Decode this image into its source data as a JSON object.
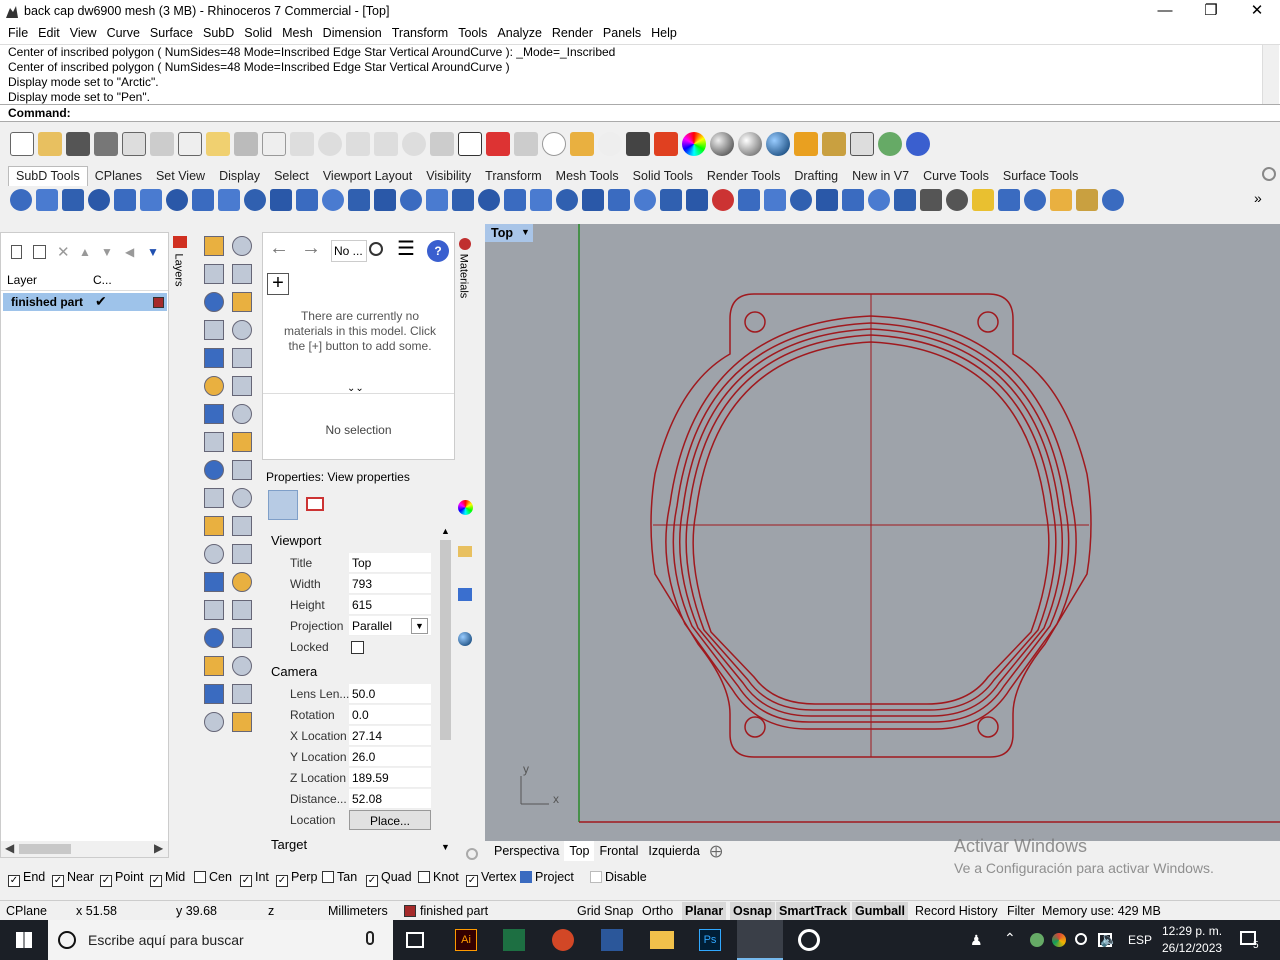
{
  "window": {
    "title": "back cap dw6900 mesh (3 MB) - Rhinoceros 7 Commercial - [Top]"
  },
  "menu": [
    "File",
    "Edit",
    "View",
    "Curve",
    "Surface",
    "SubD",
    "Solid",
    "Mesh",
    "Dimension",
    "Transform",
    "Tools",
    "Analyze",
    "Render",
    "Panels",
    "Help"
  ],
  "command_history": [
    "Center of inscribed polygon ( NumSides=48  Mode=Inscribed  Edge  Star  Vertical  AroundCurve ): _Mode=_Inscribed",
    "Center of inscribed polygon ( NumSides=48  Mode=Inscribed  Edge  Star  Vertical  AroundCurve )",
    "Display mode set to \"Arctic\".",
    "Display mode set to \"Pen\"."
  ],
  "command_label": "Command:",
  "toolbar_tabs": [
    "SubD Tools",
    "CPlanes",
    "Set View",
    "Display",
    "Select",
    "Viewport Layout",
    "Visibility",
    "Transform",
    "Mesh Tools",
    "Solid Tools",
    "Render Tools",
    "Drafting",
    "New in V7",
    "Curve Tools",
    "Surface Tools"
  ],
  "layers": {
    "tab_label": "Layers",
    "col_layer": "Layer",
    "col_current": "C...",
    "row_name": "finished part",
    "row_color": "#a52a2a"
  },
  "materials": {
    "tab_label": "Materials",
    "search_placeholder": "No ...",
    "empty_text": "There are currently no materials in this model. Click the [+] button to add some.",
    "no_selection": "No selection"
  },
  "properties": {
    "header": "Properties: View properties",
    "section_viewport": "Viewport",
    "section_camera": "Camera",
    "section_target": "Target",
    "viewport_rows": [
      {
        "label": "Title",
        "value": "Top"
      },
      {
        "label": "Width",
        "value": "793"
      },
      {
        "label": "Height",
        "value": "615"
      },
      {
        "label": "Projection",
        "value": "Parallel"
      },
      {
        "label": "Locked",
        "value": ""
      }
    ],
    "camera_rows": [
      {
        "label": "Lens Len...",
        "value": "50.0"
      },
      {
        "label": "Rotation",
        "value": "0.0"
      },
      {
        "label": "X Location",
        "value": "27.14"
      },
      {
        "label": "Y Location",
        "value": "26.0"
      },
      {
        "label": "Z Location",
        "value": "189.59"
      },
      {
        "label": "Distance...",
        "value": "52.08"
      },
      {
        "label": "Location",
        "value": "Place..."
      }
    ]
  },
  "viewport": {
    "name": "Top",
    "axis_x": "x",
    "axis_y": "y",
    "curve_color": "#a0191e"
  },
  "viewport_tabs": [
    "Perspectiva",
    "Top",
    "Frontal",
    "Izquierda"
  ],
  "activate": {
    "line1": "Activar Windows",
    "line2": "Ve a Configuración para activar Windows."
  },
  "osnaps": [
    {
      "label": "End",
      "checked": true
    },
    {
      "label": "Near",
      "checked": true
    },
    {
      "label": "Point",
      "checked": true
    },
    {
      "label": "Mid",
      "checked": true
    },
    {
      "label": "Cen",
      "checked": false
    },
    {
      "label": "Int",
      "checked": true
    },
    {
      "label": "Perp",
      "checked": true
    },
    {
      "label": "Tan",
      "checked": false
    },
    {
      "label": "Quad",
      "checked": true
    },
    {
      "label": "Knot",
      "checked": false
    },
    {
      "label": "Vertex",
      "checked": true
    },
    {
      "label": "Project",
      "checked": true
    },
    {
      "label": "Disable",
      "checked": false
    }
  ],
  "status": {
    "cplane": "CPlane",
    "x": "x 51.58",
    "y": "y 39.68",
    "z": "z",
    "units": "Millimeters",
    "layer": "finished part",
    "grid_snap": "Grid Snap",
    "ortho": "Ortho",
    "planar": "Planar",
    "osnap": "Osnap",
    "smarttrack": "SmartTrack",
    "gumball": "Gumball",
    "record_history": "Record History",
    "filter": "Filter",
    "memory": "Memory use: 429 MB"
  },
  "taskbar": {
    "search_placeholder": "Escribe aquí para buscar",
    "lang": "ESP",
    "time": "12:29 p. m.",
    "date": "26/12/2023",
    "notif": "5"
  }
}
